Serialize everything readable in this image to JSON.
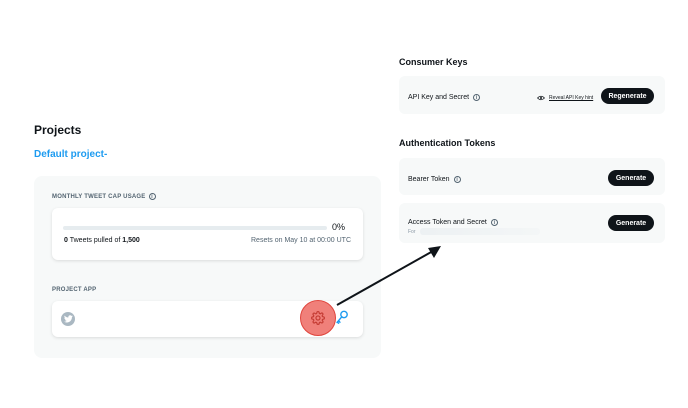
{
  "projects": {
    "title": "Projects",
    "default_project": "Default project-",
    "tweet_cap": {
      "label": "MONTHLY TWEET CAP USAGE",
      "percent_text": "0%",
      "progress": 0,
      "pulled_count": "0",
      "pulled_mid": " Tweets pulled of ",
      "pulled_limit": "1,500",
      "reset_text": "Resets on May 10 at 00:00 UTC"
    },
    "project_app": {
      "label": "PROJECT APP"
    }
  },
  "consumer_keys": {
    "heading": "Consumer Keys",
    "api_label": "API Key and Secret",
    "reveal_label": "Reveal API Key hint",
    "regenerate_label": "Regenerate"
  },
  "auth_tokens": {
    "heading": "Authentication Tokens",
    "bearer_label": "Bearer Token",
    "bearer_button": "Generate",
    "access_label": "Access Token and Secret",
    "access_sub": "For",
    "access_button": "Generate"
  },
  "colors": {
    "accent": "#1d9bf0",
    "button_dark": "#0f1419",
    "panel_bg": "#f7f9f9",
    "highlight": "#f0807a"
  },
  "icons": [
    "info-icon",
    "twitter-bird-icon",
    "gear-icon",
    "key-icon",
    "eye-icon",
    "arrow-annotation"
  ]
}
